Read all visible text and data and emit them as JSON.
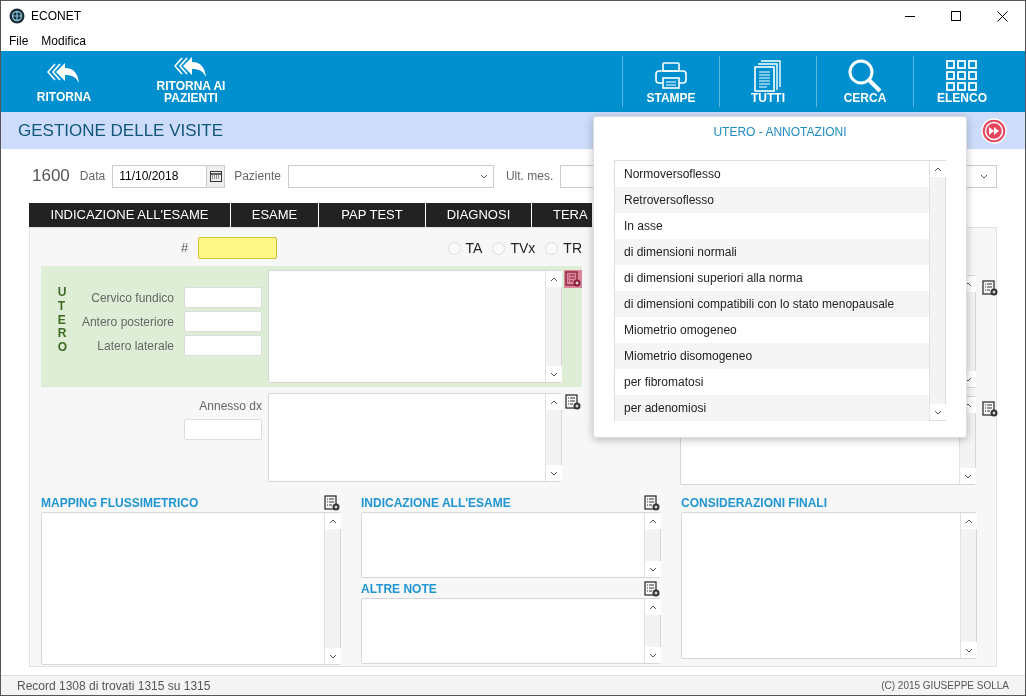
{
  "window": {
    "title": "ECONET"
  },
  "menu": [
    "File",
    "Modifica"
  ],
  "toolbar": {
    "left": [
      {
        "label": "RITORNA",
        "kind": "back"
      },
      {
        "label": "RITORNA AI PAZIENTI",
        "kind": "back"
      }
    ],
    "right": [
      {
        "label": "STAMPE",
        "kind": "printer"
      },
      {
        "label": "TUTTI",
        "kind": "documents"
      },
      {
        "label": "CERCA",
        "kind": "search"
      },
      {
        "label": "ELENCO",
        "kind": "grid"
      }
    ]
  },
  "header": {
    "title": "GESTIONE DELLE VISITE"
  },
  "record_row": {
    "number": "1600",
    "date_label": "Data",
    "date_value": "11/10/2018",
    "patient_label": "Paziente",
    "last_label": "Ult. mes."
  },
  "tabs": [
    "INDICAZIONE ALL'ESAME",
    "ESAME",
    "PAP TEST",
    "DIAGNOSI",
    "TERA"
  ],
  "exam": {
    "hash_label": "#",
    "probe_options": [
      {
        "label": "TA",
        "selected": false
      },
      {
        "label": "TVx",
        "selected": false
      },
      {
        "label": "TR",
        "selected": false
      }
    ],
    "utero": {
      "title": "UTERO",
      "fields": [
        "Cervico fundico",
        "Antero posteriore",
        "Latero laterale"
      ],
      "note_active": true
    },
    "annesso": {
      "label": "Annesso dx",
      "note_active": false
    }
  },
  "bottom_columns": [
    {
      "sections": [
        {
          "title": "MAPPING FLUSSIMETRICO"
        }
      ]
    },
    {
      "sections": [
        {
          "title": "INDICAZIONE ALL'ESAME"
        },
        {
          "title": "ALTRE NOTE"
        }
      ]
    },
    {
      "sections": [
        {
          "title": "CONSIDERAZIONI FINALI"
        }
      ]
    }
  ],
  "popup": {
    "title": "UTERO - ANNOTAZIONI",
    "items": [
      "Normoversoflesso",
      "Retroversoflesso",
      "In asse",
      "di dimensioni normali",
      "di dimensioni superiori alla norma",
      "di dimensioni compatibili con lo stato menopausale",
      "Miometrio omogeneo",
      "Miometrio disomogeneo",
      "per fibromatosi",
      "per adenomiosi"
    ]
  },
  "status_bar": {
    "record": "Record 1308 di trovati 1315 su 1315",
    "copyright": "(C) 2015 GIUSEPPE SOLLA"
  }
}
